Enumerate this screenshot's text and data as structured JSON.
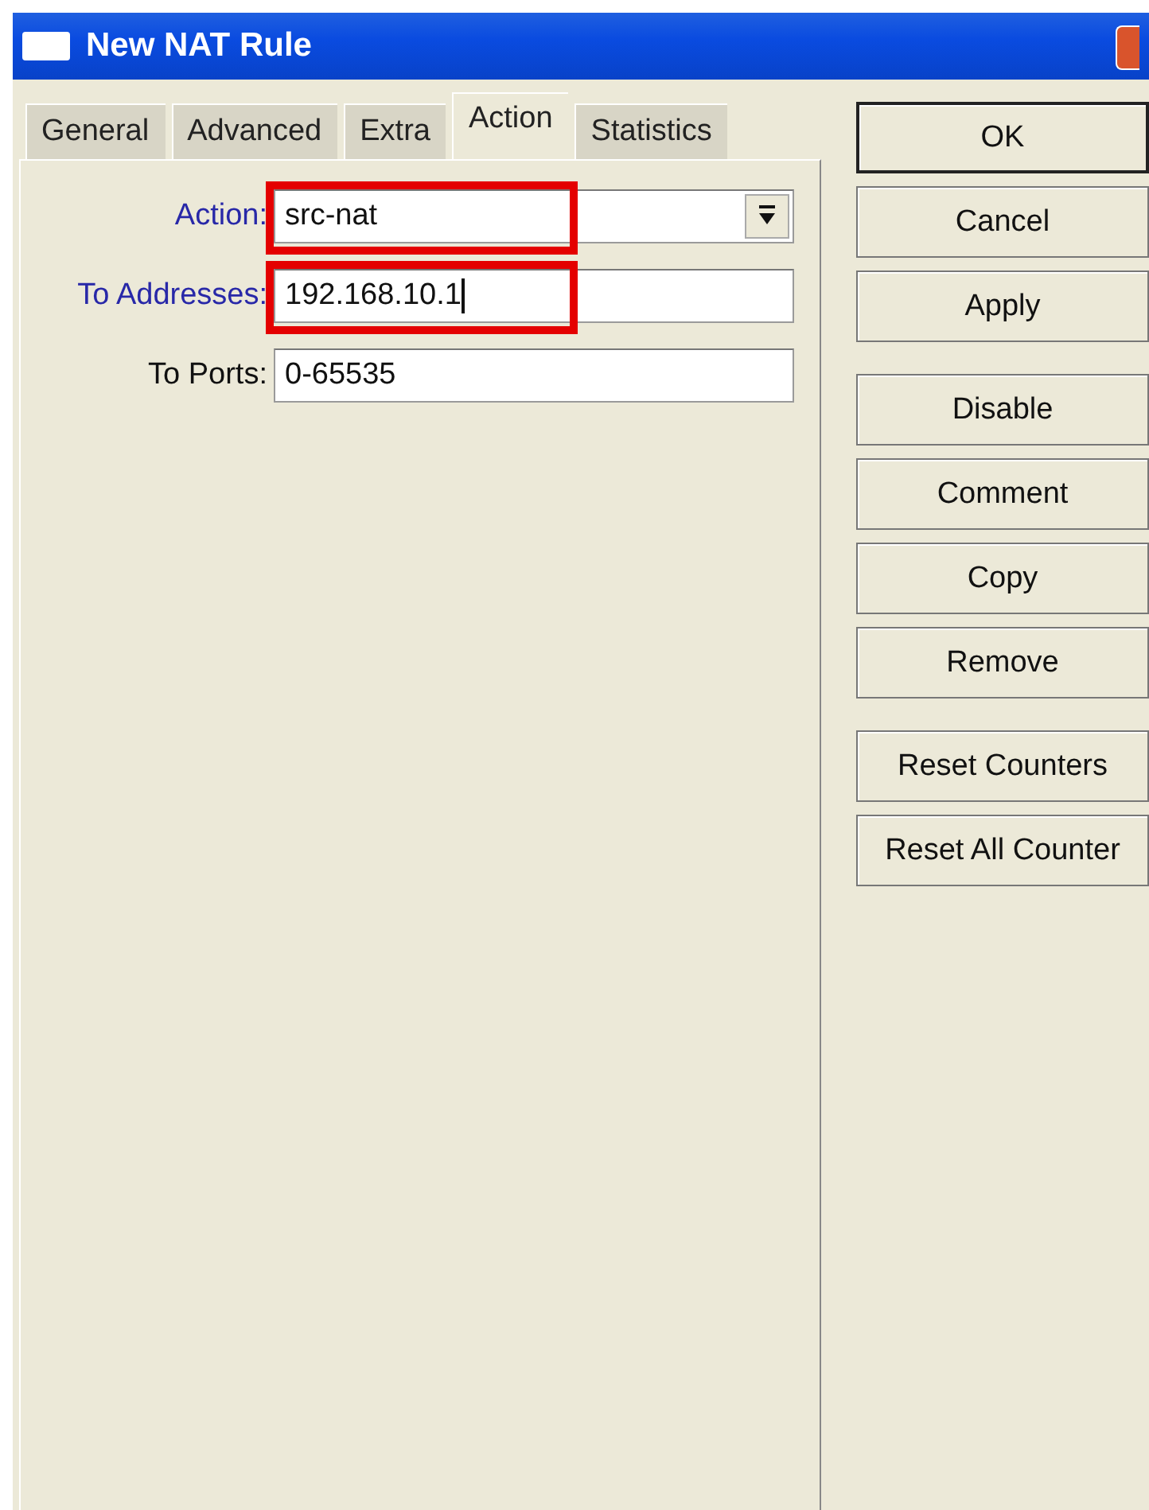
{
  "window": {
    "title": "New NAT Rule"
  },
  "tabs": [
    {
      "label": "General",
      "selected": false
    },
    {
      "label": "Advanced",
      "selected": false
    },
    {
      "label": "Extra",
      "selected": false
    },
    {
      "label": "Action",
      "selected": true
    },
    {
      "label": "Statistics",
      "selected": false
    }
  ],
  "fields": [
    {
      "kind": "dropdown",
      "label": "Action:",
      "value": "src-nat",
      "emphasized": true,
      "highlighted": true,
      "caret": false
    },
    {
      "kind": "text",
      "label": "To Addresses:",
      "value": "192.168.10.1",
      "emphasized": true,
      "highlighted": true,
      "caret": true
    },
    {
      "kind": "text",
      "label": "To Ports:",
      "value": "0-65535",
      "emphasized": false,
      "highlighted": false,
      "caret": false
    }
  ],
  "button_groups": [
    [
      "OK",
      "Cancel",
      "Apply"
    ],
    [
      "Disable",
      "Comment",
      "Copy",
      "Remove"
    ],
    [
      "Reset Counters",
      "Reset All Counter"
    ]
  ]
}
